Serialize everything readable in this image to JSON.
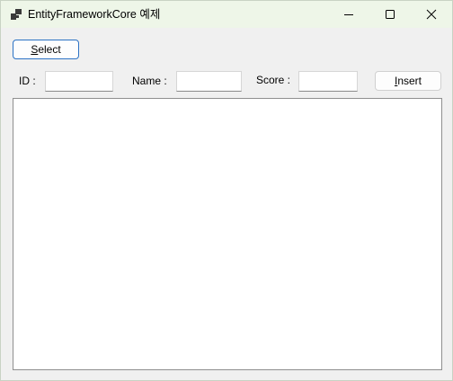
{
  "window": {
    "title": "EntityFrameworkCore 예제",
    "icon": "app-window-icon",
    "controls": {
      "minimize_icon": "minimize-icon",
      "maximize_icon": "maximize-icon",
      "close_icon": "close-icon"
    }
  },
  "toolbar": {
    "select_label_accel": "S",
    "select_label_rest": "elect",
    "insert_label_accel": "I",
    "insert_label_rest": "nsert"
  },
  "form": {
    "id_label": "ID :",
    "id_value": "",
    "name_label": "Name :",
    "name_value": "",
    "score_label": "Score :",
    "score_value": ""
  },
  "results": {
    "rows": []
  },
  "colors": {
    "titlebar": "#eef6e8",
    "window_bg": "#f0f0f0",
    "focus_border": "#2b72c4"
  }
}
